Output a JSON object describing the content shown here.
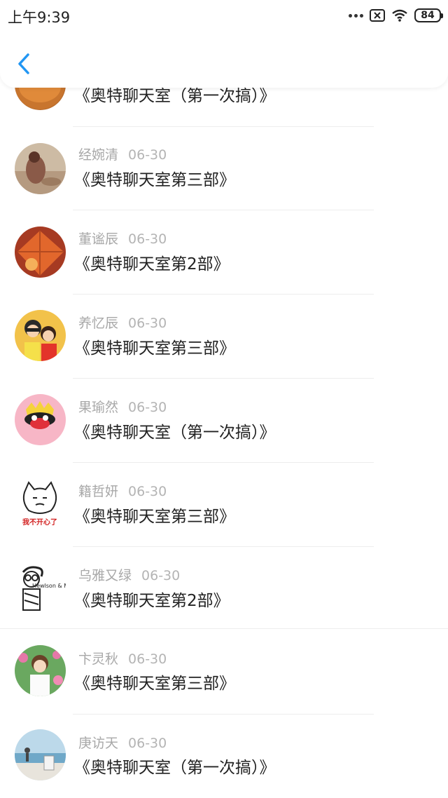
{
  "status_bar": {
    "time": "上午9:39",
    "battery": "84"
  },
  "messages": [
    {
      "name": "",
      "date": "",
      "title": "《奥特聊天室（第一次搞）》",
      "avatar": "pumpkin-avatar"
    },
    {
      "name": "经婉清",
      "date": "06-30",
      "title": "《奥特聊天室第三部》",
      "avatar": "girl-beach-avatar"
    },
    {
      "name": "董谧辰",
      "date": "06-30",
      "title": "《奥特聊天室第2部》",
      "avatar": "orange-leaf-avatar"
    },
    {
      "name": "养忆辰",
      "date": "06-30",
      "title": "《奥特聊天室第三部》",
      "avatar": "cartoon-couple-avatar"
    },
    {
      "name": "果瑜然",
      "date": "06-30",
      "title": "《奥特聊天室（第一次搞）》",
      "avatar": "monkey-crown-avatar"
    },
    {
      "name": "籍哲妍",
      "date": "06-30",
      "title": "《奥特聊天室第三部》",
      "avatar": "unhappy-cat-avatar"
    },
    {
      "name": "乌雅又绿",
      "date": "06-30",
      "title": "《奥特聊天室第2部》",
      "avatar": "sketch-boy-avatar"
    },
    {
      "name": "卞灵秋",
      "date": "06-30",
      "title": "《奥特聊天室第三部》",
      "avatar": "girl-flowers-avatar"
    },
    {
      "name": "庚访天",
      "date": "06-30",
      "title": "《奥特聊天室（第一次搞）》",
      "avatar": "seaside-avatar"
    }
  ],
  "avatar_texts": {
    "unhappy_cat": "我不开心了",
    "sketch_boy": "Hewlson & Moe"
  },
  "colors": {
    "accent": "#2196f3",
    "name_gray": "#a8a8a8"
  }
}
